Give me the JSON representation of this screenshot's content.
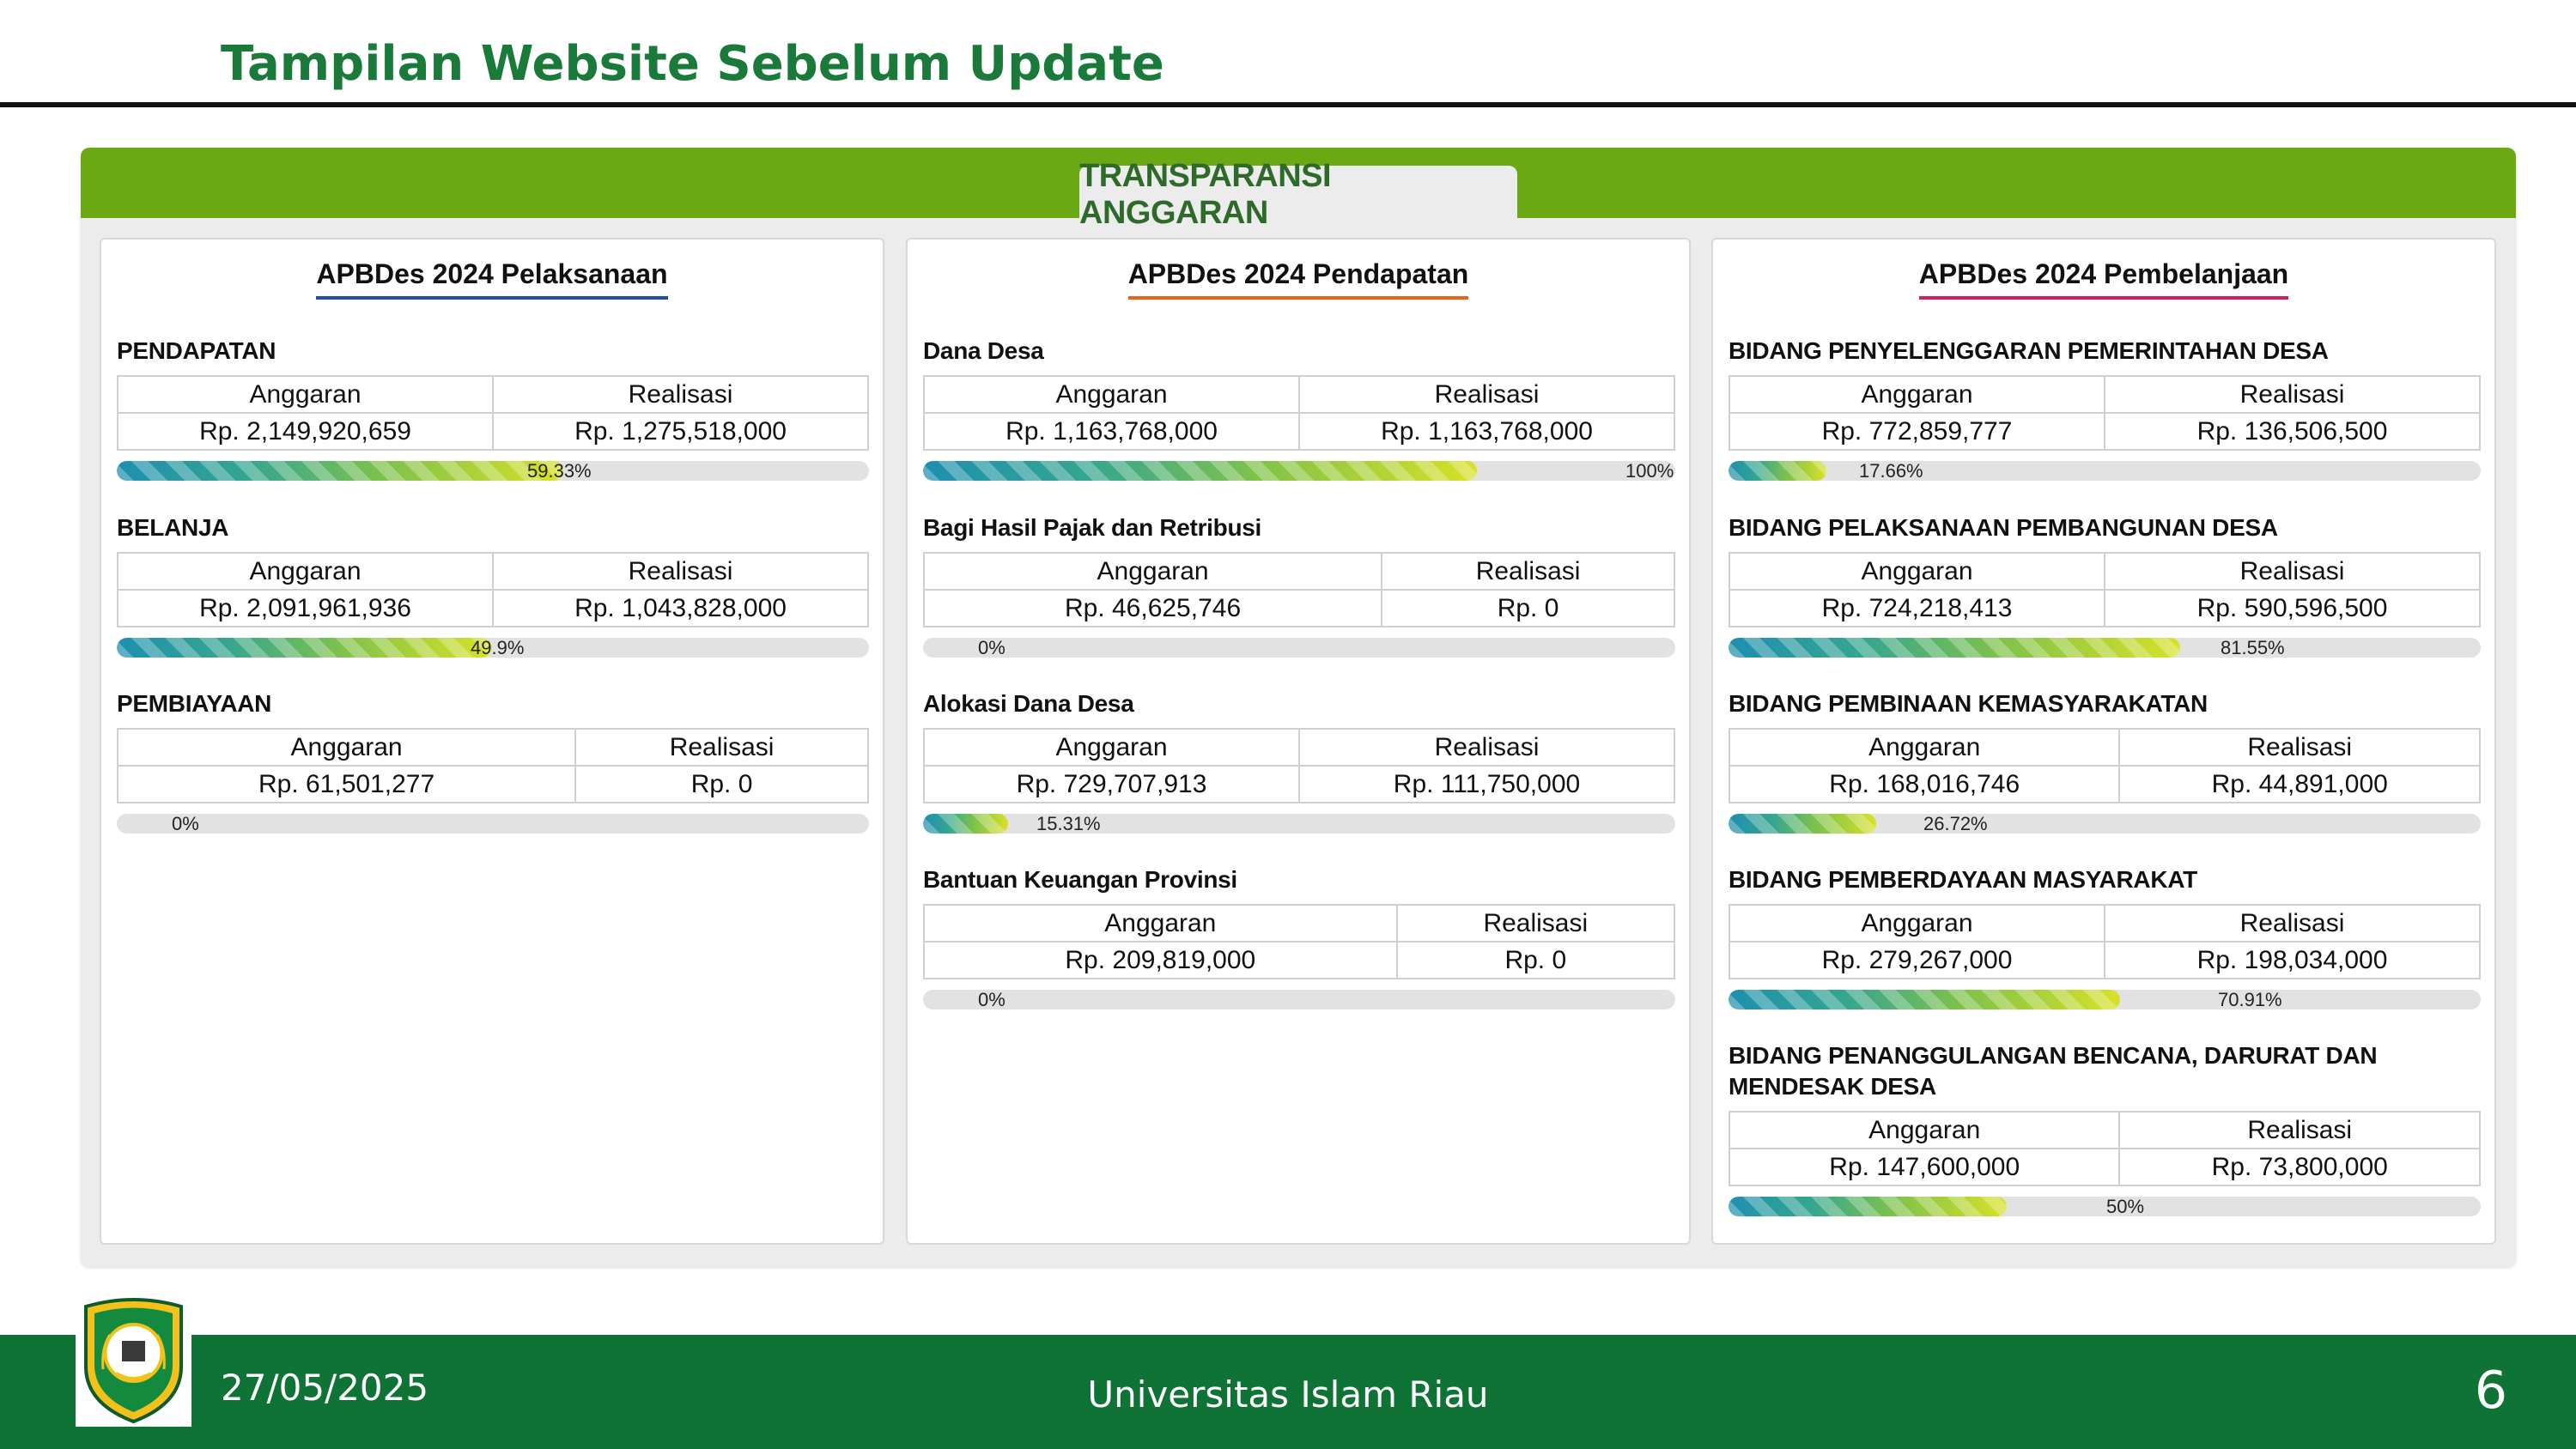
{
  "slide": {
    "title": "Tampilan Website Sebelum Update",
    "date": "27/05/2025",
    "organization": "Universitas Islam Riau",
    "page_number": "6"
  },
  "website": {
    "banner_title": "TRANSPARANSI ANGGARAN",
    "accent_color": "#6aa914",
    "panels": [
      {
        "title": "APBDes 2024 Pelaksanaan",
        "underline_color": "#1f4fa0",
        "sections": [
          {
            "label": "PENDAPATAN",
            "col_anggaran": "Anggaran",
            "col_realisasi": "Realisasi",
            "anggaran": "Rp. 2,149,920,659",
            "realisasi": "Rp. 1,275,518,000",
            "percent_label": "59.33%",
            "percent": 59.33
          },
          {
            "label": "BELANJA",
            "col_anggaran": "Anggaran",
            "col_realisasi": "Realisasi",
            "anggaran": "Rp. 2,091,961,936",
            "realisasi": "Rp. 1,043,828,000",
            "percent_label": "49.9%",
            "percent": 49.9
          },
          {
            "label": "PEMBIAYAAN",
            "col_anggaran": "Anggaran",
            "col_realisasi": "Realisasi",
            "anggaran": "Rp. 61,501,277",
            "realisasi": "Rp. 0",
            "percent_label": "0%",
            "percent": 0
          }
        ]
      },
      {
        "title": "APBDes 2024 Pendapatan",
        "underline_color": "#e8641e",
        "sections": [
          {
            "label": "Dana Desa",
            "col_anggaran": "Anggaran",
            "col_realisasi": "Realisasi",
            "anggaran": "Rp. 1,163,768,000",
            "realisasi": "Rp. 1,163,768,000",
            "percent_label": "100%",
            "percent": 100
          },
          {
            "label": "Bagi Hasil Pajak dan Retribusi",
            "col_anggaran": "Anggaran",
            "col_realisasi": "Realisasi",
            "anggaran": "Rp. 46,625,746",
            "realisasi": "Rp. 0",
            "percent_label": "0%",
            "percent": 0
          },
          {
            "label": "Alokasi Dana Desa",
            "col_anggaran": "Anggaran",
            "col_realisasi": "Realisasi",
            "anggaran": "Rp. 729,707,913",
            "realisasi": "Rp. 111,750,000",
            "percent_label": "15.31%",
            "percent": 15.31
          },
          {
            "label": "Bantuan Keuangan Provinsi",
            "col_anggaran": "Anggaran",
            "col_realisasi": "Realisasi",
            "anggaran": "Rp. 209,819,000",
            "realisasi": "Rp. 0",
            "percent_label": "0%",
            "percent": 0
          }
        ]
      },
      {
        "title": "APBDes 2024 Pembelanjaan",
        "underline_color": "#d1205a",
        "sections": [
          {
            "label": "BIDANG PENYELENGGARAN PEMERINTAHAN DESA",
            "col_anggaran": "Anggaran",
            "col_realisasi": "Realisasi",
            "anggaran": "Rp. 772,859,777",
            "realisasi": "Rp. 136,506,500",
            "percent_label": "17.66%",
            "percent": 17.66
          },
          {
            "label": "BIDANG PELAKSANAAN PEMBANGUNAN DESA",
            "col_anggaran": "Anggaran",
            "col_realisasi": "Realisasi",
            "anggaran": "Rp. 724,218,413",
            "realisasi": "Rp. 590,596,500",
            "percent_label": "81.55%",
            "percent": 81.55
          },
          {
            "label": "BIDANG PEMBINAAN KEMASYARAKATAN",
            "col_anggaran": "Anggaran",
            "col_realisasi": "Realisasi",
            "anggaran": "Rp. 168,016,746",
            "realisasi": "Rp. 44,891,000",
            "percent_label": "26.72%",
            "percent": 26.72
          },
          {
            "label": "BIDANG PEMBERDAYAAN MASYARAKAT",
            "col_anggaran": "Anggaran",
            "col_realisasi": "Realisasi",
            "anggaran": "Rp. 279,267,000",
            "realisasi": "Rp. 198,034,000",
            "percent_label": "70.91%",
            "percent": 70.91
          },
          {
            "label": "BIDANG PENANGGULANGAN BENCANA, DARURAT DAN MENDESAK DESA",
            "col_anggaran": "Anggaran",
            "col_realisasi": "Realisasi",
            "anggaran": "Rp. 147,600,000",
            "realisasi": "Rp. 73,800,000",
            "percent_label": "50%",
            "percent": 50
          }
        ]
      }
    ]
  },
  "colors": {
    "title_green": "#1a7a3a",
    "footer_green": "#0f7336"
  },
  "icons": {
    "logo": "regional-crest-logo"
  }
}
